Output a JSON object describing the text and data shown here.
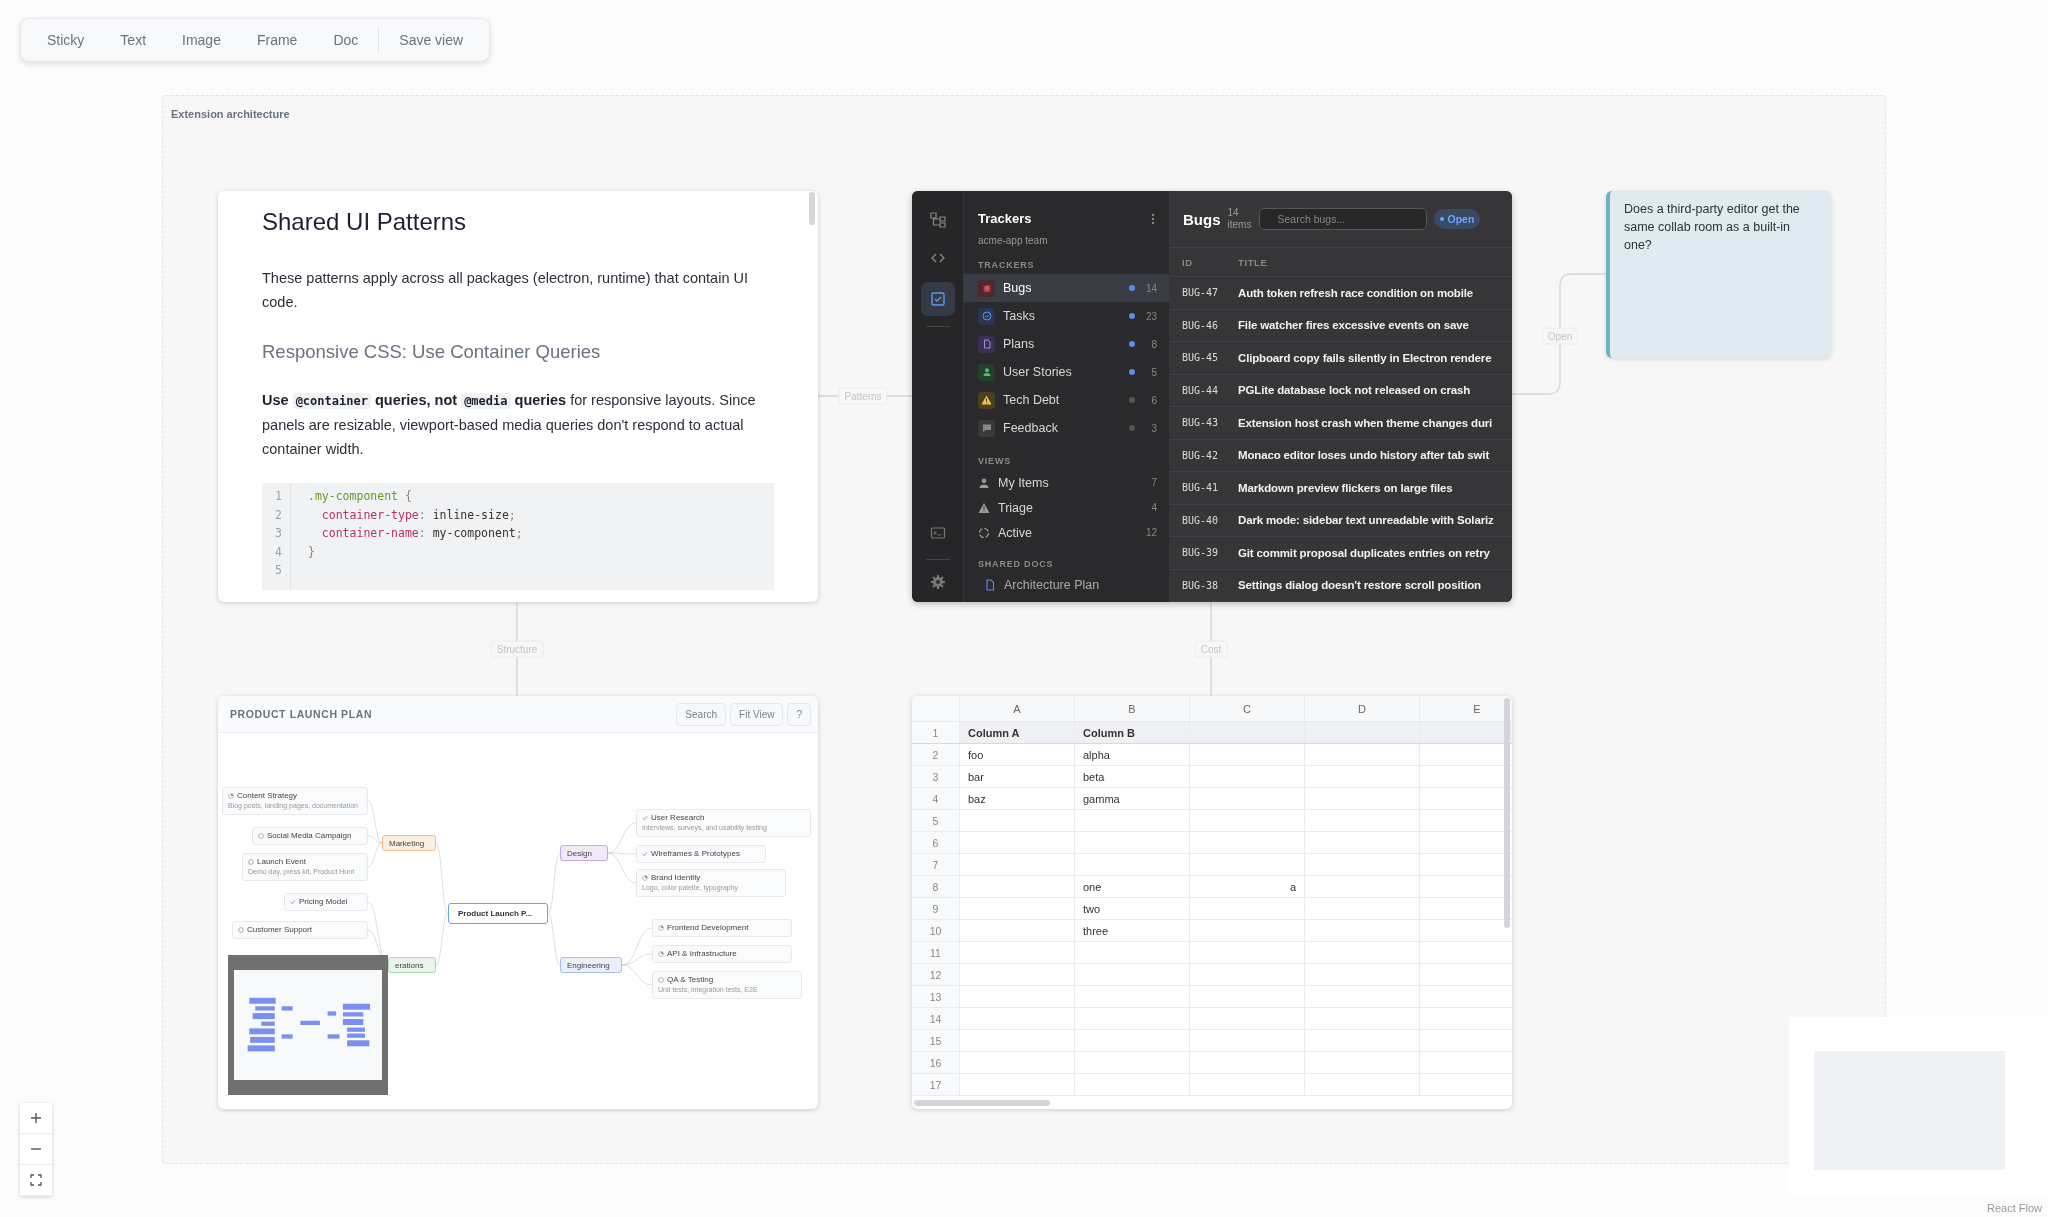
{
  "toolbar": {
    "tools": [
      "Sticky",
      "Text",
      "Image",
      "Frame",
      "Doc"
    ],
    "save": "Save view"
  },
  "frame": {
    "label": "Extension architecture"
  },
  "doc": {
    "title": "Shared UI Patterns",
    "intro": "These patterns apply across all packages (electron, runtime) that contain UI code.",
    "heading": "Responsive CSS: Use Container Queries",
    "paragraph": [
      {
        "text": "Use ",
        "kind": "bold"
      },
      {
        "text": "@container",
        "kind": "code"
      },
      {
        "text": " queries, not ",
        "kind": "bold"
      },
      {
        "text": "@media",
        "kind": "code"
      },
      {
        "text": " queries",
        "kind": "bold"
      },
      {
        "text": " for responsive layouts. Since panels are resizable, viewport-based media queries don't respond to actual container width.",
        "kind": "plain"
      }
    ],
    "code": [
      {
        "number": "1",
        "tokens": [
          {
            "text": ".my-component",
            "kind": "selector"
          },
          {
            "text": " {",
            "kind": "punct"
          }
        ]
      },
      {
        "number": "2",
        "tokens": [
          {
            "text": "  container-type",
            "kind": "property"
          },
          {
            "text": ": ",
            "kind": "punct"
          },
          {
            "text": "inline-size",
            "kind": "value"
          },
          {
            "text": ";",
            "kind": "punct"
          }
        ]
      },
      {
        "number": "3",
        "tokens": [
          {
            "text": "  container-name",
            "kind": "property"
          },
          {
            "text": ": ",
            "kind": "punct"
          },
          {
            "text": "my-component",
            "kind": "value"
          },
          {
            "text": ";",
            "kind": "punct"
          }
        ]
      },
      {
        "number": "4",
        "tokens": [
          {
            "text": "}",
            "kind": "punct"
          }
        ]
      },
      {
        "number": "5"
      }
    ]
  },
  "tracker": {
    "title": "Trackers",
    "team": "acme-app team",
    "sections": [
      {
        "heading": "TRACKERS",
        "kind": "trackers",
        "items": [
          {
            "label": "Bugs",
            "count": "14",
            "selected": true,
            "color": "#5b8def"
          },
          {
            "label": "Tasks",
            "count": "23",
            "selected": false,
            "color": "#5b8def"
          },
          {
            "label": "Plans",
            "count": "8",
            "selected": false,
            "color": "#5b8def"
          },
          {
            "label": "User Stories",
            "count": "5",
            "selected": false,
            "color": "#5b8def"
          },
          {
            "label": "Tech Debt",
            "count": "6",
            "selected": false,
            "color": "#555555"
          },
          {
            "label": "Feedback",
            "count": "3",
            "selected": false,
            "color": "#555555"
          }
        ]
      },
      {
        "heading": "VIEWS",
        "kind": "views",
        "items": [
          {
            "label": "My Items",
            "count": "7",
            "selected": false
          },
          {
            "label": "Triage",
            "count": "4",
            "selected": false
          },
          {
            "label": "Active",
            "count": "12",
            "selected": false
          }
        ]
      },
      {
        "heading": "SHARED DOCS",
        "kind": "docs",
        "items": [
          {
            "label": "Architecture Plan",
            "selected": false
          }
        ]
      }
    ],
    "list": {
      "title": "Bugs",
      "count": "14 items",
      "search_placeholder": "Search bugs...",
      "filter": "Open",
      "columns": [
        "ID",
        "TITLE"
      ],
      "rows": [
        {
          "id": "BUG-47",
          "title": "Auth token refresh race condition on mobile"
        },
        {
          "id": "BUG-46",
          "title": "File watcher fires excessive events on save"
        },
        {
          "id": "BUG-45",
          "title": "Clipboard copy fails silently in Electron rendere"
        },
        {
          "id": "BUG-44",
          "title": "PGLite database lock not released on crash"
        },
        {
          "id": "BUG-43",
          "title": "Extension host crash when theme changes duri"
        },
        {
          "id": "BUG-42",
          "title": "Monaco editor loses undo history after tab swit"
        },
        {
          "id": "BUG-41",
          "title": "Markdown preview flickers on large files"
        },
        {
          "id": "BUG-40",
          "title": "Dark mode: sidebar text unreadable with Solariz"
        },
        {
          "id": "BUG-39",
          "title": "Git commit proposal duplicates entries on retry"
        },
        {
          "id": "BUG-38",
          "title": "Settings dialog doesn't restore scroll position"
        }
      ]
    }
  },
  "sticky": {
    "text": "Does a third-party editor get the same collab room as a built-in one?"
  },
  "edges": [
    {
      "label": "Patterns"
    },
    {
      "label": "Open"
    },
    {
      "label": "Structure"
    },
    {
      "label": "Cost"
    }
  ],
  "mindmap": {
    "title": "PRODUCT LAUNCH PLAN",
    "buttons": [
      "Search",
      "Fit View",
      "?"
    ],
    "root": {
      "label": "Product Launch P...",
      "children": [
        {
          "label": "Marketing",
          "color": "#f0c088",
          "children": [
            {
              "label": "Content Strategy",
              "description": "Blog posts, landing pages, documentation",
              "kind": "progress"
            },
            {
              "label": "Social Media Campaign",
              "kind": "todo"
            },
            {
              "label": "Launch Event",
              "description": "Demo day, press kit, Product Hunt",
              "kind": "todo"
            }
          ]
        },
        {
          "label": "erations",
          "color": "#a8d8ab",
          "children": [
            {
              "label": "Pricing Model",
              "kind": "done"
            },
            {
              "label": "Customer Support",
              "kind": "todo"
            }
          ]
        },
        {
          "label": "Design",
          "color": "#c9a6e3",
          "children": [
            {
              "label": "User Research",
              "description": "Interviews, surveys, and usability testing",
              "kind": "done"
            },
            {
              "label": "Wireframes & Prototypes",
              "kind": "done"
            },
            {
              "label": "Brand Identity",
              "description": "Logo, color palette, typography",
              "kind": "progress"
            }
          ]
        },
        {
          "label": "Engineering",
          "color": "#a7c1e6",
          "children": [
            {
              "label": "Frontend Development",
              "kind": "progress"
            },
            {
              "label": "API & Infrastructure",
              "kind": "progress"
            },
            {
              "label": "QA & Testing",
              "description": "Unit tests, integration tests, E2E",
              "kind": "todo"
            }
          ]
        }
      ]
    }
  },
  "sheet": {
    "columns": [
      "A",
      "B",
      "C",
      "D",
      "E"
    ],
    "rows": [
      {
        "number": "1",
        "header": true,
        "cells": {
          "A": "Column A",
          "B": "Column B"
        }
      },
      {
        "number": "2",
        "header": false,
        "cells": {
          "A": "foo",
          "B": "alpha"
        }
      },
      {
        "number": "3",
        "header": false,
        "cells": {
          "A": "bar",
          "B": "beta"
        }
      },
      {
        "number": "4",
        "header": false,
        "cells": {
          "A": "baz",
          "B": "gamma"
        }
      },
      {
        "number": "5",
        "header": false
      },
      {
        "number": "6",
        "header": false
      },
      {
        "number": "7",
        "header": false
      },
      {
        "number": "8",
        "header": false,
        "cells": {
          "B": "one",
          "C": {
            "text": "a",
            "right_aligned": true
          }
        }
      },
      {
        "number": "9",
        "header": false,
        "cells": {
          "B": "two"
        }
      },
      {
        "number": "10",
        "header": false,
        "cells": {
          "B": "three"
        }
      },
      {
        "number": "11",
        "header": false
      },
      {
        "number": "12",
        "header": false
      },
      {
        "number": "13",
        "header": false
      },
      {
        "number": "14",
        "header": false
      },
      {
        "number": "15",
        "header": false
      },
      {
        "number": "16",
        "header": false
      },
      {
        "number": "17",
        "header": false
      }
    ]
  },
  "attribution": "React Flow"
}
